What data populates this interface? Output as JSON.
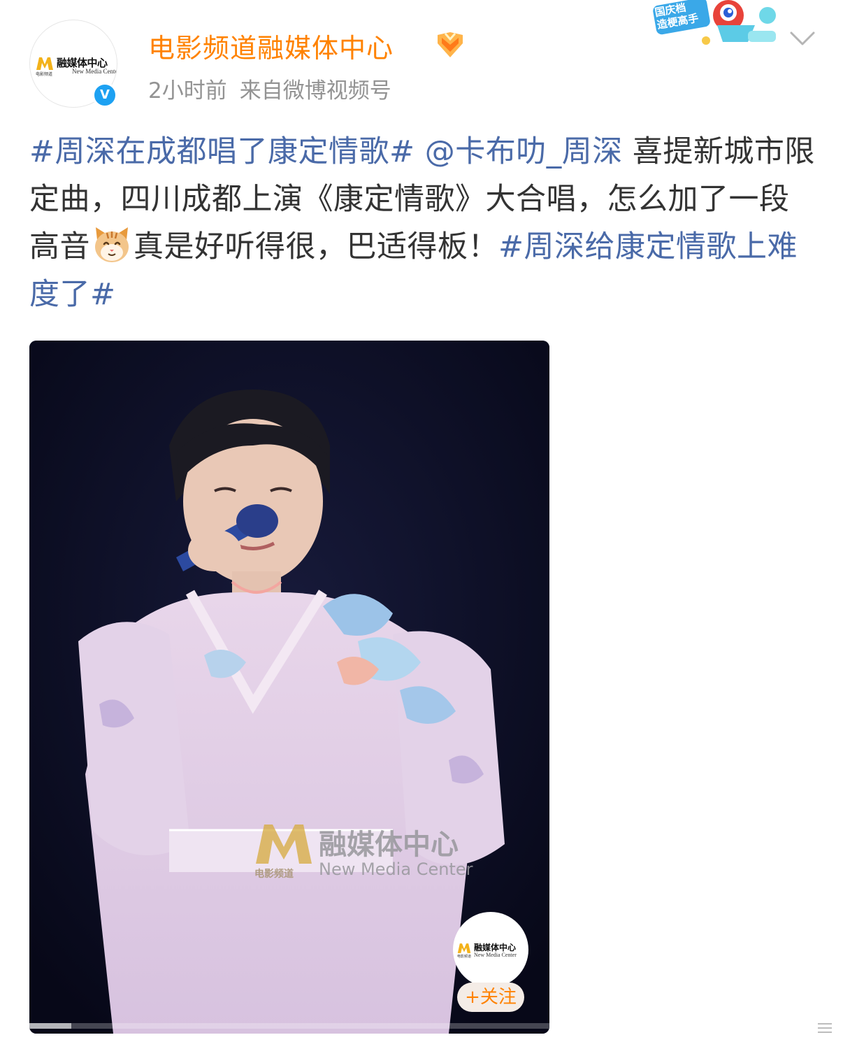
{
  "header": {
    "username": "电影频道融媒体中心",
    "time": "2小时前",
    "source": "来自微博视频号",
    "avatar": {
      "logo_cn": "融媒体中心",
      "logo_en": "New Media Center",
      "logo_sub": "电影频道"
    },
    "verified_icon": "verified-v-icon",
    "event_badge": {
      "line1": "国庆档",
      "line2": "造梗高手"
    }
  },
  "post": {
    "hashtag1": "#周深在成都唱了康定情歌#",
    "mention": "@卡布叻_周深",
    "text1": " 喜提新城市限定曲，四川成都上演《康定情歌》大合唱，怎么加了一段高音",
    "emoji": "cat-face-emoji",
    "text2": "真是好听得很，巴适得板！",
    "hashtag2": "#周深给康定情歌上难度了#"
  },
  "video": {
    "watermark_cn": "融媒体中心",
    "watermark_en": "New Media Center",
    "watermark_sub": "电影频道",
    "follow_avatar_cn": "融媒体中心",
    "follow_avatar_en": "New Media Center",
    "follow_avatar_sub": "电影频道",
    "follow_label": "+关注",
    "progress": 0.08
  },
  "colors": {
    "username": "#ff8200",
    "link": "#4a6aa8",
    "meta": "#939393",
    "body_text": "#333333"
  }
}
